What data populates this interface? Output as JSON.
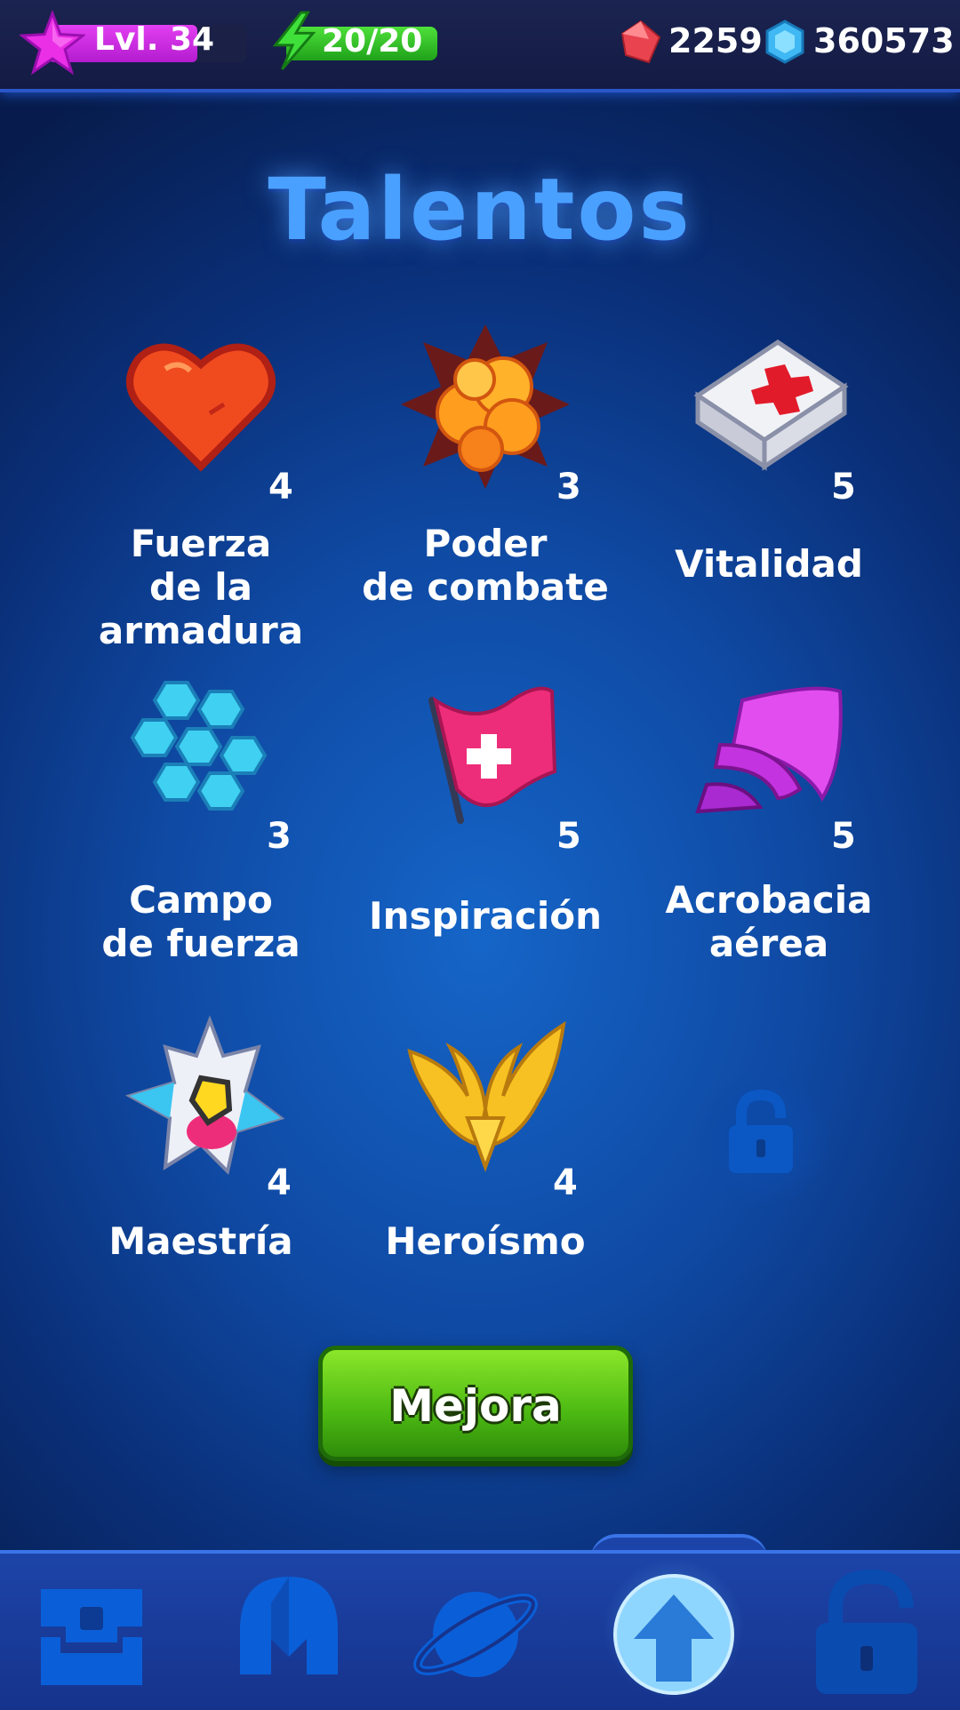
{
  "hud": {
    "level_label": "Lvl. 34",
    "level_progress": 0.75,
    "energy_label": "20/20",
    "energy_progress": 1.0,
    "rubies": "2259",
    "crystals": "360573",
    "colors": {
      "level": "#d62fe9",
      "energy": "#35c52a",
      "ruby": "#e8434f",
      "crystal": "#3fb8f4"
    }
  },
  "title": "Talentos",
  "talents": [
    {
      "name": "Fuerza\nde la armadura",
      "level": "4",
      "icon": "heart-icon"
    },
    {
      "name": "Poder\nde combate",
      "level": "3",
      "icon": "explosion-icon"
    },
    {
      "name": "Vitalidad",
      "level": "5",
      "icon": "first-aid-kit-icon"
    },
    {
      "name": "Campo\nde fuerza",
      "level": "3",
      "icon": "hexagon-shield-icon"
    },
    {
      "name": "Inspiración",
      "level": "5",
      "icon": "medic-flag-icon"
    },
    {
      "name": "Acrobacia\naérea",
      "level": "5",
      "icon": "speed-wings-icon"
    },
    {
      "name": "Maestría",
      "level": "4",
      "icon": "spaceship-icon"
    },
    {
      "name": "Heroísmo",
      "level": "4",
      "icon": "golden-wings-icon"
    }
  ],
  "locked_slot_icon": "padlock-icon",
  "upgrade_button": "Mejora",
  "nav": [
    {
      "icon": "chest-icon",
      "active": false
    },
    {
      "icon": "helmet-icon",
      "active": false
    },
    {
      "icon": "planet-icon",
      "active": false
    },
    {
      "icon": "upgrade-arrow-icon",
      "active": true
    },
    {
      "icon": "padlock-icon",
      "active": false
    }
  ]
}
